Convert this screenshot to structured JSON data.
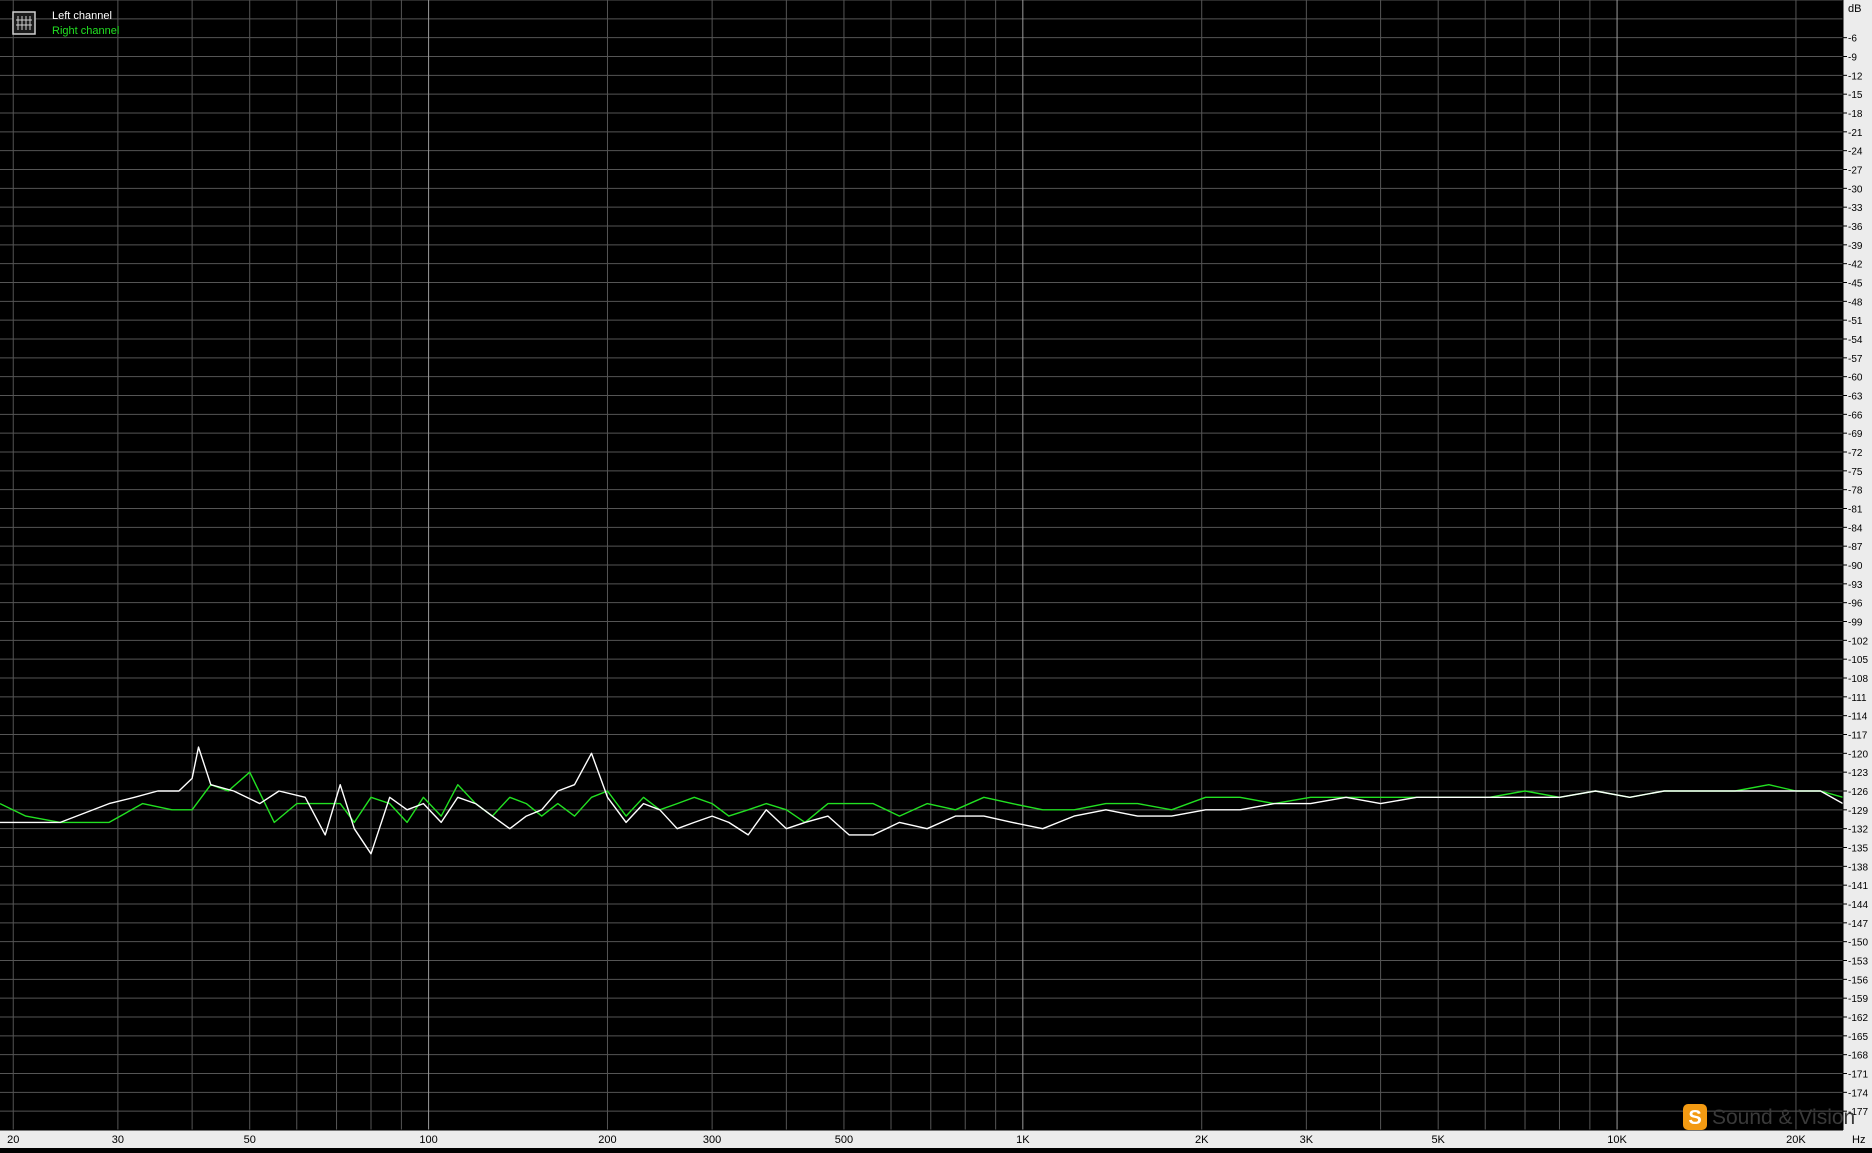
{
  "legend": {
    "entries": [
      {
        "label": "Left channel",
        "color": "#ffffff"
      },
      {
        "label": "Right channel",
        "color": "#22e022"
      }
    ],
    "icon": "spectrum-icon"
  },
  "watermark": {
    "text": "Sound & Vision",
    "icon": "logo-icon"
  },
  "chart_data": {
    "type": "line",
    "title": "",
    "xlabel": "Hz",
    "ylabel": "dB",
    "x_scale": "log",
    "xlim": [
      19,
      24000
    ],
    "ylim": [
      -180,
      0
    ],
    "grid": true,
    "legend_position": "top-left",
    "x_ticks": [
      {
        "value": 20,
        "label": "20"
      },
      {
        "value": 30,
        "label": "30"
      },
      {
        "value": 50,
        "label": "50"
      },
      {
        "value": 100,
        "label": "100"
      },
      {
        "value": 200,
        "label": "200"
      },
      {
        "value": 300,
        "label": "300"
      },
      {
        "value": 500,
        "label": "500"
      },
      {
        "value": 1000,
        "label": "1K"
      },
      {
        "value": 2000,
        "label": "2K"
      },
      {
        "value": 3000,
        "label": "3K"
      },
      {
        "value": 5000,
        "label": "5K"
      },
      {
        "value": 10000,
        "label": "10K"
      },
      {
        "value": 20000,
        "label": "20K"
      }
    ],
    "y_tick_step": 3,
    "y_ticks": [
      -6,
      -9,
      -12,
      -15,
      -18,
      -21,
      -24,
      -27,
      -30,
      -33,
      -36,
      -39,
      -42,
      -45,
      -48,
      -51,
      -54,
      -57,
      -60,
      -63,
      -66,
      -69,
      -72,
      -75,
      -78,
      -81,
      -84,
      -87,
      -90,
      -93,
      -96,
      -99,
      -102,
      -105,
      -108,
      -111,
      -114,
      -117,
      -120,
      -123,
      -126,
      -129,
      -132,
      -135,
      -138,
      -141,
      -144,
      -147,
      -150,
      -153,
      -156,
      -159,
      -162,
      -165,
      -168,
      -171,
      -174,
      -177
    ],
    "series": [
      {
        "name": "Left channel",
        "color": "#ffffff",
        "x": [
          19,
          24,
          29,
          32,
          35,
          38,
          40,
          41,
          43,
          47,
          52,
          56,
          62,
          67,
          71,
          75,
          80,
          86,
          92,
          98,
          105,
          112,
          120,
          128,
          137,
          146,
          155,
          165,
          176,
          188,
          200,
          215,
          230,
          245,
          262,
          280,
          300,
          320,
          345,
          370,
          400,
          430,
          470,
          510,
          560,
          620,
          690,
          770,
          860,
          960,
          1080,
          1220,
          1380,
          1560,
          1780,
          2030,
          2320,
          2650,
          3050,
          3500,
          4000,
          4600,
          5300,
          6100,
          7000,
          8000,
          9200,
          10500,
          12000,
          13800,
          15800,
          18000,
          20000,
          22000,
          24000
        ],
        "y": [
          -131,
          -131,
          -128,
          -127,
          -126,
          -126,
          -124,
          -119,
          -125,
          -126,
          -128,
          -126,
          -127,
          -133,
          -125,
          -132,
          -136,
          -127,
          -129,
          -128,
          -131,
          -127,
          -128,
          -130,
          -132,
          -130,
          -129,
          -126,
          -125,
          -120,
          -127,
          -131,
          -128,
          -129,
          -132,
          -131,
          -130,
          -131,
          -133,
          -129,
          -132,
          -131,
          -130,
          -133,
          -133,
          -131,
          -132,
          -130,
          -130,
          -131,
          -132,
          -130,
          -129,
          -130,
          -130,
          -129,
          -129,
          -128,
          -128,
          -127,
          -128,
          -127,
          -127,
          -127,
          -127,
          -127,
          -126,
          -127,
          -126,
          -126,
          -126,
          -126,
          -126,
          -126,
          -128
        ]
      },
      {
        "name": "Right channel",
        "color": "#22e022",
        "x": [
          19,
          21,
          24,
          29,
          33,
          37,
          40,
          43,
          46,
          50,
          55,
          60,
          66,
          71,
          75,
          80,
          86,
          92,
          98,
          105,
          112,
          120,
          128,
          137,
          146,
          155,
          165,
          176,
          188,
          200,
          215,
          230,
          245,
          262,
          280,
          300,
          320,
          345,
          370,
          400,
          430,
          470,
          510,
          560,
          620,
          690,
          770,
          860,
          960,
          1080,
          1220,
          1380,
          1560,
          1780,
          2030,
          2320,
          2650,
          3050,
          3500,
          4000,
          4600,
          5300,
          6100,
          7000,
          8000,
          9200,
          10500,
          12000,
          13800,
          15800,
          18000,
          20000,
          22000,
          24000
        ],
        "y": [
          -128,
          -130,
          -131,
          -131,
          -128,
          -129,
          -129,
          -125,
          -126,
          -123,
          -131,
          -128,
          -128,
          -128,
          -131,
          -127,
          -128,
          -131,
          -127,
          -130,
          -125,
          -128,
          -130,
          -127,
          -128,
          -130,
          -128,
          -130,
          -127,
          -126,
          -130,
          -127,
          -129,
          -128,
          -127,
          -128,
          -130,
          -129,
          -128,
          -129,
          -131,
          -128,
          -128,
          -128,
          -130,
          -128,
          -129,
          -127,
          -128,
          -129,
          -129,
          -128,
          -128,
          -129,
          -127,
          -127,
          -128,
          -127,
          -127,
          -127,
          -127,
          -127,
          -127,
          -126,
          -127,
          -126,
          -127,
          -126,
          -126,
          -126,
          -125,
          -126,
          -126,
          -127
        ]
      }
    ]
  }
}
